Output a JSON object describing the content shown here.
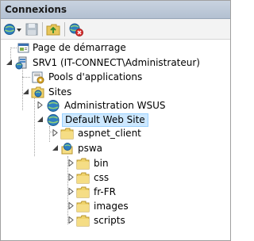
{
  "panel": {
    "title": "Connexions"
  },
  "toolbar": {
    "items": [
      "connect-icon",
      "save-icon",
      "up-folder-icon",
      "disconnect-icon"
    ]
  },
  "tree": {
    "start_page": "Page de démarrage",
    "server": "SRV1 (IT-CONNECT\\Administrateur)",
    "app_pools": "Pools d'applications",
    "sites": "Sites",
    "site_wsus": "Administration WSUS",
    "site_default": "Default Web Site",
    "aspnet_client": "aspnet_client",
    "pswa": "pswa",
    "bin": "bin",
    "css": "css",
    "fr_fr": "fr-FR",
    "images": "images",
    "scripts": "scripts"
  },
  "colors": {
    "selection_bg": "#cde8ff",
    "selection_border": "#99d1ff",
    "title_bg": "#c2cedc"
  }
}
